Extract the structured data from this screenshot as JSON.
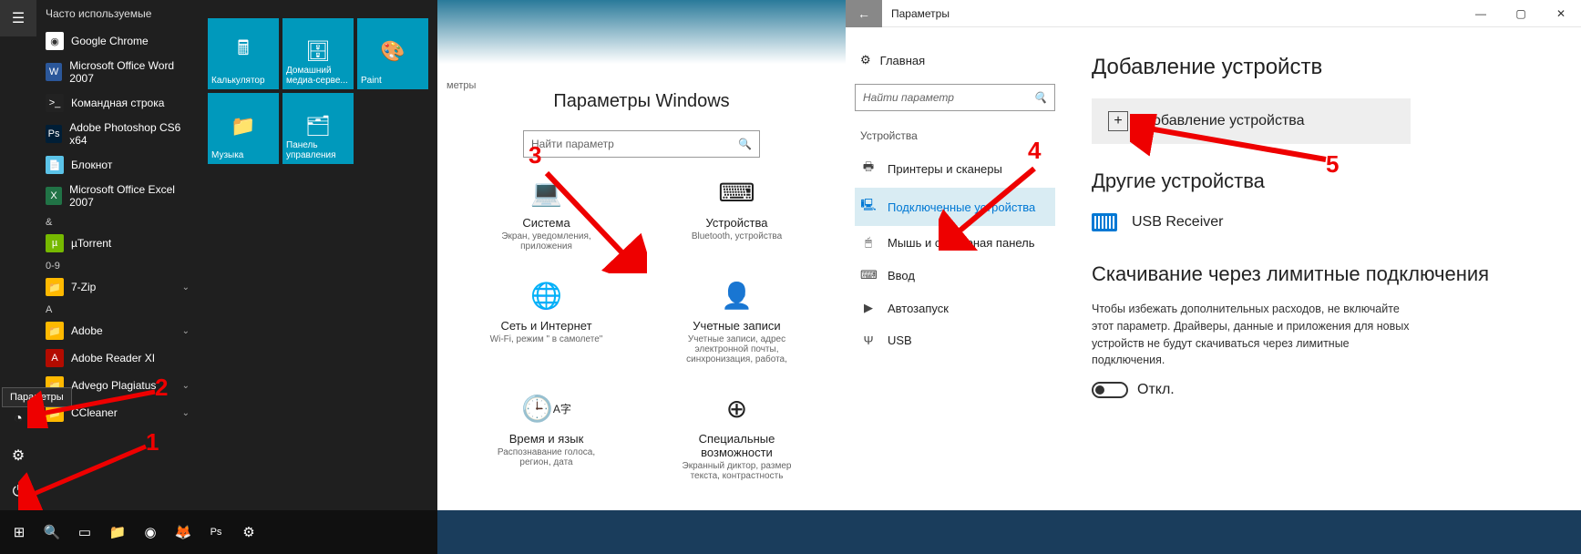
{
  "start": {
    "header": "Часто используемые",
    "apps": [
      {
        "label": "Google Chrome",
        "color": "#fff"
      },
      {
        "label": "Microsoft Office Word 2007",
        "color": "#2b579a"
      },
      {
        "label": "Командная строка",
        "color": "#222"
      },
      {
        "label": "Adobe Photoshop CS6 x64",
        "color": "#001e36"
      },
      {
        "label": "Блокнот",
        "color": "#5bc3e8"
      },
      {
        "label": "Microsoft Office Excel 2007",
        "color": "#217346"
      }
    ],
    "letters": [
      {
        "letter": "&",
        "items": [
          {
            "label": "µTorrent",
            "color": "#76b900"
          }
        ]
      },
      {
        "letter": "0-9",
        "items": [
          {
            "label": "7-Zip",
            "folder": true
          }
        ]
      },
      {
        "letter": "A",
        "items": [
          {
            "label": "Adobe",
            "folder": true
          },
          {
            "label": "Adobe Reader XI",
            "color": "#b30b00"
          },
          {
            "label": "Advego Plagiatus",
            "folder": true
          },
          {
            "label": "CCleaner",
            "folder": true
          }
        ]
      }
    ],
    "tiles": [
      [
        {
          "label": "Калькулятор"
        },
        {
          "label": "Домашний медиа-серве..."
        },
        {
          "label": "Paint"
        }
      ],
      [
        {
          "label": "Музыка"
        },
        {
          "label": "Панель управления"
        }
      ]
    ],
    "tooltip": "Параметры"
  },
  "settingsHome": {
    "breadcrumb": "метры",
    "title": "Параметры Windows",
    "searchPlaceholder": "Найти параметр",
    "cats": [
      {
        "title": "Система",
        "sub": "Экран, уведомления, приложения"
      },
      {
        "title": "Устройства",
        "sub": "Bluetooth, устройства"
      },
      {
        "title": "Сеть и Интернет",
        "sub": "Wi-Fi, режим \" в самолете\""
      },
      {
        "title": "Учетные записи",
        "sub": "Учетные записи, адрес электронной почты, синхронизация, работа,"
      },
      {
        "title": "Время и язык",
        "sub": "Распознавание голоса, регион, дата"
      },
      {
        "title": "Специальные возможности",
        "sub": "Экранный диктор, размер текста, контрастность"
      }
    ]
  },
  "deviceSettings": {
    "windowTitle": "Параметры",
    "home": "Главная",
    "searchPlaceholder": "Найти параметр",
    "sidebarHeader": "Устройства",
    "sidebar": [
      {
        "label": "Принтеры и сканеры"
      },
      {
        "label": "Подключенные устройства",
        "active": true
      },
      {
        "label": "Мышь и сенсорная панель"
      },
      {
        "label": "Ввод"
      },
      {
        "label": "Автозапуск"
      },
      {
        "label": "USB"
      }
    ],
    "h_add": "Добавление устройств",
    "addBtn": "Добавление устройства",
    "h_other": "Другие устройства",
    "devices": [
      {
        "label": "USB Receiver"
      }
    ],
    "h_metered": "Скачивание через лимитные подключения",
    "meteredText": "Чтобы избежать дополнительных расходов, не включайте этот параметр. Драйверы, данные и приложения для новых устройств не будут скачиваться через лимитные подключения.",
    "toggleLabel": "Откл."
  },
  "annotations": {
    "n1": "1",
    "n2": "2",
    "n3": "3",
    "n4": "4",
    "n5": "5"
  }
}
